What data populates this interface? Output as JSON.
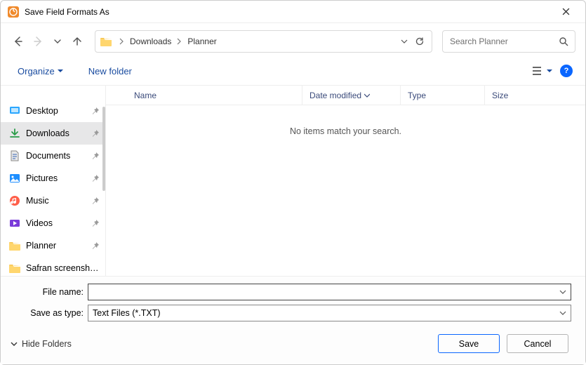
{
  "titlebar": {
    "title": "Save Field Formats As"
  },
  "breadcrumbs": [
    "Downloads",
    "Planner"
  ],
  "search": {
    "placeholder": "Search Planner"
  },
  "toolbar": {
    "organize": "Organize",
    "newfolder": "New folder"
  },
  "sidebar": {
    "items": [
      {
        "label": "Desktop",
        "icon": "desktop",
        "pinned": true,
        "selected": false
      },
      {
        "label": "Downloads",
        "icon": "download",
        "pinned": true,
        "selected": true
      },
      {
        "label": "Documents",
        "icon": "document",
        "pinned": true,
        "selected": false
      },
      {
        "label": "Pictures",
        "icon": "picture",
        "pinned": true,
        "selected": false
      },
      {
        "label": "Music",
        "icon": "music",
        "pinned": true,
        "selected": false
      },
      {
        "label": "Videos",
        "icon": "video",
        "pinned": true,
        "selected": false
      },
      {
        "label": "Planner",
        "icon": "folder",
        "pinned": true,
        "selected": false
      },
      {
        "label": "Safran screenshots",
        "icon": "folder",
        "pinned": false,
        "selected": false
      }
    ]
  },
  "columns": {
    "name": "Name",
    "date": "Date modified",
    "type": "Type",
    "size": "Size"
  },
  "empty_text": "No items match your search.",
  "form": {
    "filename_label": "File name:",
    "filename_value": "",
    "savetype_label": "Save as type:",
    "savetype_value": "Text Files (*.TXT)"
  },
  "actions": {
    "hide_folders": "Hide Folders",
    "save": "Save",
    "cancel": "Cancel"
  }
}
